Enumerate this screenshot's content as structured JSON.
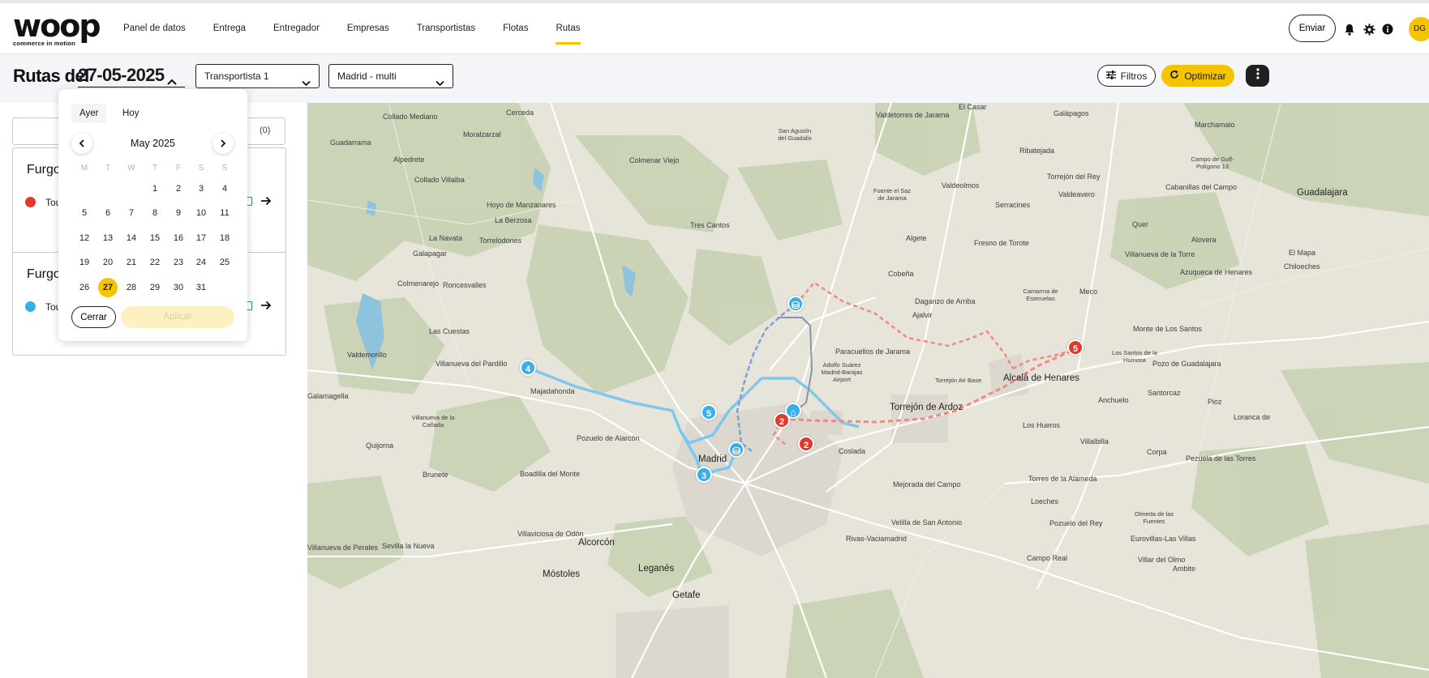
{
  "header": {
    "logo_word": "woop",
    "logo_tagline": "commerce in motion",
    "nav": [
      "Panel de datos",
      "Entrega",
      "Entregador",
      "Empresas",
      "Transportistas",
      "Flotas",
      "Rutas"
    ],
    "active_nav": "Rutas",
    "send_label": "Enviar",
    "avatar_initials": "DG"
  },
  "toolbar": {
    "title_prefix": "Rutas del",
    "date": "27-05-2025",
    "carrier_select": "Transportista 1",
    "region_select": "Madrid - multi",
    "filters_label": "Filtros",
    "optimize_label": "Optimizar"
  },
  "panel": {
    "tab_count": "(0)",
    "routes": [
      {
        "name": "Furgo",
        "tour": "Tou",
        "color": "#e03a2e"
      },
      {
        "name": "Furgo",
        "tour": "Tou",
        "color": "#3aaee6"
      }
    ]
  },
  "calendar": {
    "yesterday": "Ayer",
    "today": "Hoy",
    "month_label": "May 2025",
    "weekdays": [
      "M",
      "T",
      "W",
      "T",
      "F",
      "S",
      "S"
    ],
    "weeks": [
      [
        "",
        "",
        "",
        "1",
        "2",
        "3",
        "4"
      ],
      [
        "5",
        "6",
        "7",
        "8",
        "9",
        "10",
        "11"
      ],
      [
        "12",
        "13",
        "14",
        "15",
        "16",
        "17",
        "18"
      ],
      [
        "19",
        "20",
        "21",
        "22",
        "23",
        "24",
        "25"
      ],
      [
        "26",
        "27",
        "28",
        "29",
        "30",
        "31",
        ""
      ]
    ],
    "selected_day": "27",
    "close_label": "Cerrar",
    "apply_label": "Aplicar"
  },
  "map": {
    "places": [
      "Cerceda",
      "Collado Mediano",
      "Moralzarzal",
      "Guadarrama",
      "Alpedrete",
      "Collado Villalba",
      "Colmenar Viejo",
      "San Agustín del Guadalix",
      "El Casar",
      "Valdetorres de Jarama",
      "Galápagos",
      "Marchamalo",
      "Ribatejada",
      "Campo de Golf-Polígono 13",
      "Torrejón del Rey",
      "Cabanillas del Campo",
      "Guadalajara",
      "Valdeavero",
      "Fuente el Saz de Jarama",
      "Valdeolmos",
      "Hoyo de Manzanares",
      "La Berzosa",
      "Serracines",
      "Quer",
      "Tres Cantos",
      "Algete",
      "Fresno de Torote",
      "Alovera",
      "La Navata",
      "Torrelodones",
      "Galapagar",
      "Villanueva de la Torre",
      "El Mapa",
      "Chiloeches",
      "Azuqueca de Henares",
      "Colmenarejo",
      "Roncesvalles",
      "Cobeña",
      "Daganzo de Arriba",
      "Camarma de Esteruelas",
      "Meco",
      "Ajalvir",
      "Las Cuestas",
      "Monte de Los Santos",
      "Valdemorillo",
      "Villanueva del Pardillo",
      "Paracuellos de Jarama",
      "Adolfo Suárez Madrid-Barajas Airport",
      "Torrejón Air Base",
      "Alcalá de Henares",
      "Los Santos de la Humosa",
      "Pozo de Guadalajara",
      "Majadahonda",
      "Torrejón de Ardoz",
      "Anchuelo",
      "Santorcaz",
      "Galamagella",
      "Villanueva de la Cañada",
      "Pozuelo de Alarcón",
      "Los Hueros",
      "Pioz",
      "Loranca de",
      "Quijorna",
      "Villalbilla",
      "Madrid",
      "Coslada",
      "Corpa",
      "Brunete",
      "Boadilla del Monte",
      "Mejorada del Campo",
      "Torres de la Alameda",
      "Pezuela de las Torres",
      "Loeches",
      "Villaviciosa de Odón",
      "Velilla de San Antonio",
      "Olmeda de las Fuentes",
      "Pozuelo del Rey",
      "Eurovillas-Las Villas",
      "Alcorcón",
      "Rivas-Vaciamadrid",
      "Villanueva de Perales",
      "Sevilla la Nueva",
      "Campo Real",
      "Villar del Olmo",
      "Móstoles",
      "Leganés",
      "Ambite",
      "Getafe"
    ],
    "markers": [
      {
        "label": "4",
        "color": "blue"
      },
      {
        "label": "5",
        "color": "blue"
      },
      {
        "label": "3",
        "color": "blue"
      },
      {
        "label": "2",
        "color": "red"
      },
      {
        "label": "2",
        "color": "red"
      },
      {
        "label": "5",
        "color": "red"
      }
    ]
  }
}
